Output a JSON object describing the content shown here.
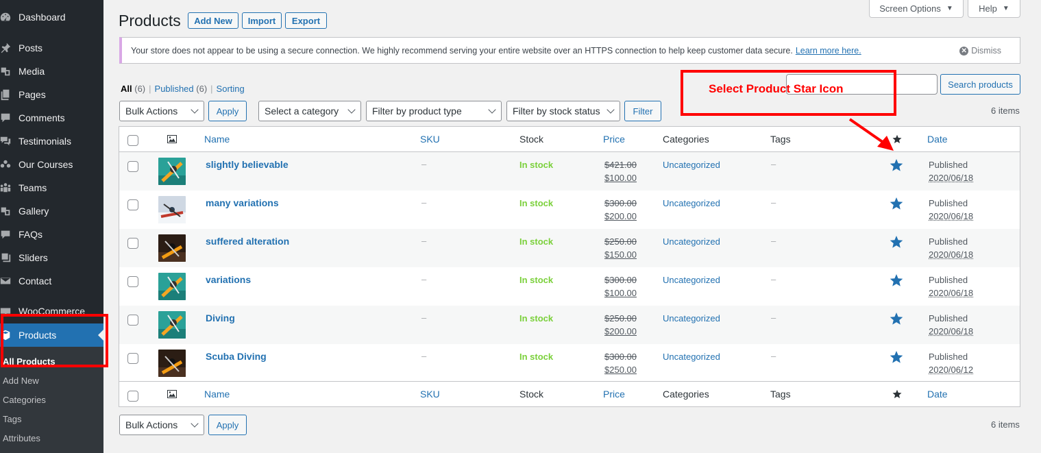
{
  "sidebar": {
    "items": [
      {
        "label": "Dashboard",
        "icon": "dashboard-icon"
      },
      {
        "label": "Posts",
        "icon": "pin-icon"
      },
      {
        "label": "Media",
        "icon": "media-icon"
      },
      {
        "label": "Pages",
        "icon": "pages-icon"
      },
      {
        "label": "Comments",
        "icon": "comment-icon"
      },
      {
        "label": "Testimonials",
        "icon": "testimonial-icon"
      },
      {
        "label": "Our Courses",
        "icon": "groups-icon"
      },
      {
        "label": "Teams",
        "icon": "team-icon"
      },
      {
        "label": "Gallery",
        "icon": "gallery-icon"
      },
      {
        "label": "FAQs",
        "icon": "faq-icon"
      },
      {
        "label": "Sliders",
        "icon": "slider-icon"
      },
      {
        "label": "Contact",
        "icon": "mail-icon"
      },
      {
        "label": "WooCommerce",
        "icon": "woo-icon"
      },
      {
        "label": "Products",
        "icon": "products-icon"
      }
    ],
    "submenu": [
      "All Products",
      "Add New",
      "Categories",
      "Tags",
      "Attributes"
    ]
  },
  "header": {
    "title": "Products",
    "add_new": "Add New",
    "import": "Import",
    "export": "Export",
    "screen_options": "Screen Options",
    "help": "Help"
  },
  "notice": {
    "text": "Your store does not appear to be using a secure connection. We highly recommend serving your entire website over an HTTPS connection to help keep customer data secure.",
    "link": "Learn more here.",
    "dismiss": "Dismiss"
  },
  "views": {
    "all": "All",
    "all_count": "(6)",
    "published": "Published",
    "published_count": "(6)",
    "sorting": "Sorting"
  },
  "search": {
    "button": "Search products",
    "value": ""
  },
  "filters": {
    "bulk_actions": "Bulk Actions",
    "apply": "Apply",
    "category": "Select a category",
    "product_type": "Filter by product type",
    "stock_status": "Filter by stock status",
    "filter": "Filter",
    "items": "6 items"
  },
  "columns": {
    "name": "Name",
    "sku": "SKU",
    "stock": "Stock",
    "price": "Price",
    "categories": "Categories",
    "tags": "Tags",
    "date": "Date"
  },
  "products": [
    {
      "name": "slightly believable",
      "sku": "–",
      "stock": "In stock",
      "regular": "$421.00",
      "sale": "$100.00",
      "category": "Uncategorized",
      "tags": "–",
      "status": "Published",
      "date": "2020/06/18",
      "thumb": "kayak-teal"
    },
    {
      "name": "many variations",
      "sku": "–",
      "stock": "In stock",
      "regular": "$300.00",
      "sale": "$200.00",
      "category": "Uncategorized",
      "tags": "–",
      "status": "Published",
      "date": "2020/06/18",
      "thumb": "kayak-white"
    },
    {
      "name": "suffered alteration",
      "sku": "–",
      "stock": "In stock",
      "regular": "$250.00",
      "sale": "$150.00",
      "category": "Uncategorized",
      "tags": "–",
      "status": "Published",
      "date": "2020/06/18",
      "thumb": "kayak-dark"
    },
    {
      "name": "variations",
      "sku": "–",
      "stock": "In stock",
      "regular": "$300.00",
      "sale": "$100.00",
      "category": "Uncategorized",
      "tags": "–",
      "status": "Published",
      "date": "2020/06/18",
      "thumb": "kayak-teal"
    },
    {
      "name": "Diving",
      "sku": "–",
      "stock": "In stock",
      "regular": "$250.00",
      "sale": "$200.00",
      "category": "Uncategorized",
      "tags": "–",
      "status": "Published",
      "date": "2020/06/18",
      "thumb": "kayak-teal"
    },
    {
      "name": "Scuba Diving",
      "sku": "–",
      "stock": "In stock",
      "regular": "$300.00",
      "sale": "$250.00",
      "category": "Uncategorized",
      "tags": "–",
      "status": "Published",
      "date": "2020/06/12",
      "thumb": "kayak-dark"
    }
  ],
  "annotation": {
    "text": "Select Product Star Icon"
  },
  "colors": {
    "accent": "#2271b1",
    "stock": "#7ad03a",
    "annotation": "#ff0000",
    "sidebar": "#23282d"
  }
}
